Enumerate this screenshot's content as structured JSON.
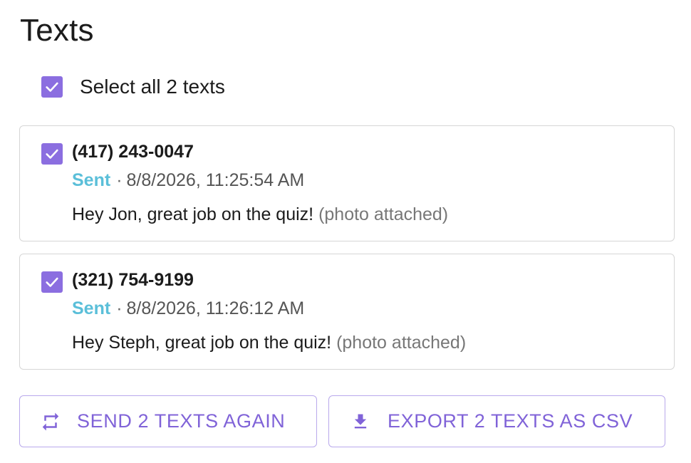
{
  "page": {
    "title": "Texts"
  },
  "select_all": {
    "label": "Select all 2 texts",
    "checked": true
  },
  "messages": [
    {
      "phone": "(417) 243-0047",
      "status": "Sent",
      "separator": "·",
      "timestamp": "8/8/2026, 11:25:54 AM",
      "text": "Hey Jon, great job on the quiz!",
      "attachment_note": "(photo attached)",
      "checked": true
    },
    {
      "phone": "(321) 754-9199",
      "status": "Sent",
      "separator": "·",
      "timestamp": "8/8/2026, 11:26:12 AM",
      "text": "Hey Steph, great job on the quiz!",
      "attachment_note": "(photo attached)",
      "checked": true
    }
  ],
  "actions": {
    "send_again": {
      "label": "SEND 2 TEXTS AGAIN",
      "icon": "repeat-icon"
    },
    "export_csv": {
      "label": "EXPORT 2 TEXTS AS CSV",
      "icon": "download-icon"
    }
  },
  "colors": {
    "accent": "#8b6ee0",
    "button_text": "#8063d8",
    "button_border": "#b9a9ec",
    "status_sent": "#5bbfd9",
    "card_border": "#d6d6d6"
  }
}
